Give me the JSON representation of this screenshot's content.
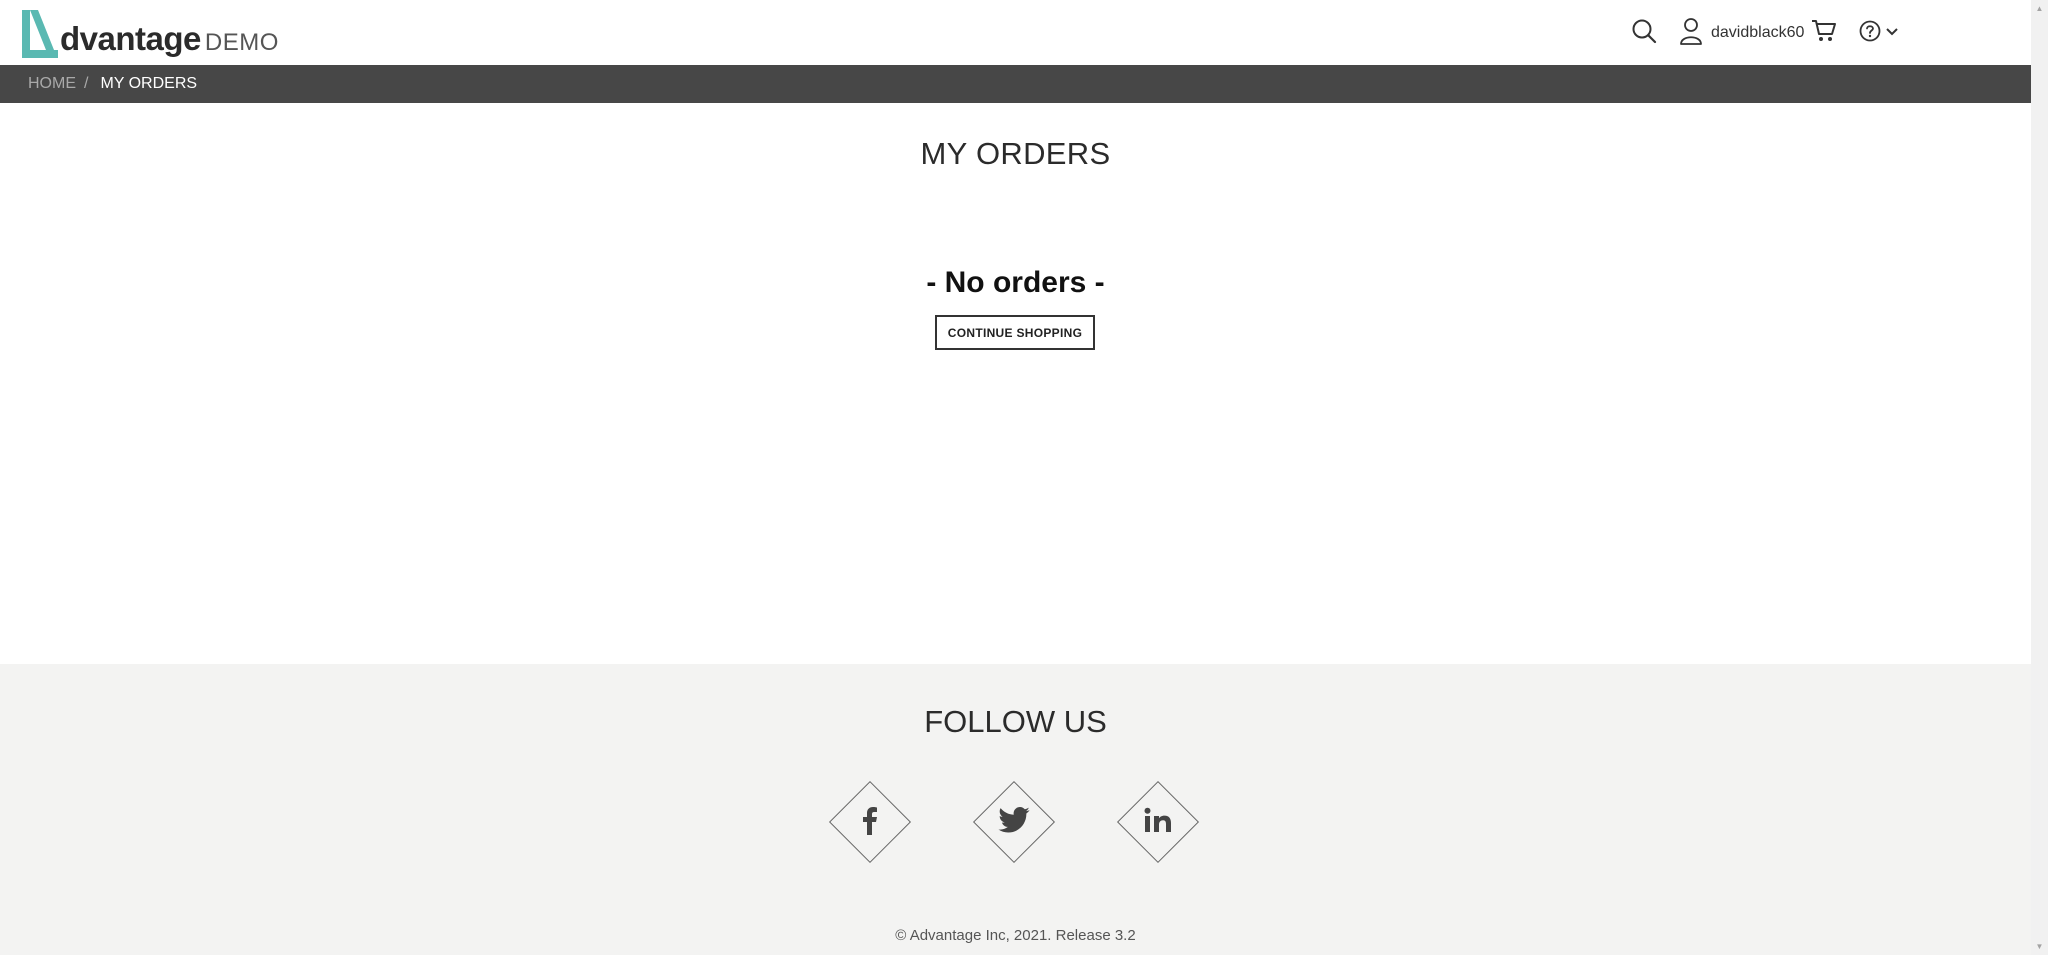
{
  "header": {
    "logo_word": "dvantage",
    "logo_demo": "DEMO",
    "username": "davidblack60",
    "icons": {
      "search": "search-icon",
      "user": "user-icon",
      "cart": "cart-icon",
      "help": "help-icon",
      "dropdown": "chevron-down-icon"
    }
  },
  "breadcrumb": {
    "home": "HOME",
    "separator": "/",
    "current": "MY ORDERS"
  },
  "main": {
    "title": "MY ORDERS",
    "empty_message": "- No orders -",
    "continue_label": "CONTINUE SHOPPING"
  },
  "footer": {
    "follow_title": "FOLLOW US",
    "social": [
      "facebook-icon",
      "twitter-icon",
      "linkedin-icon"
    ],
    "copyright": "© Advantage Inc, 2021. Release 3.2"
  },
  "colors": {
    "brand_teal": "#5ab9b2",
    "breadcrumb_bg": "#474747",
    "footer_bg": "#f3f3f2"
  }
}
